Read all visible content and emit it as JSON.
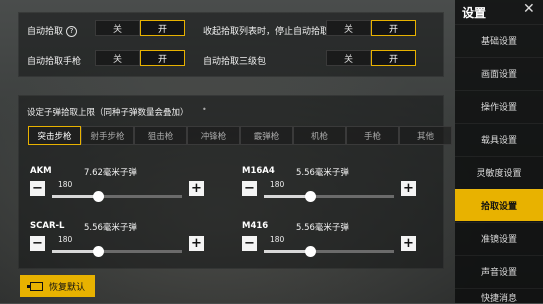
{
  "sidebar": {
    "title": "设置",
    "items": [
      {
        "label": "基础设置"
      },
      {
        "label": "画面设置"
      },
      {
        "label": "操作设置"
      },
      {
        "label": "载具设置"
      },
      {
        "label": "灵敏度设置"
      },
      {
        "label": "拾取设置",
        "active": true
      },
      {
        "label": "准镜设置"
      },
      {
        "label": "声音设置"
      },
      {
        "label": "快捷消息"
      }
    ]
  },
  "toggles": [
    {
      "label": "自动拾取",
      "off": "关",
      "on": "开",
      "value": "开",
      "has_help": true
    },
    {
      "label": "收起拾取列表时，停止自动拾取",
      "off": "关",
      "on": "开",
      "value": "开"
    },
    {
      "label": "自动拾取手枪",
      "off": "关",
      "on": "开",
      "value": "开"
    },
    {
      "label": "自动拾取三级包",
      "off": "关",
      "on": "开",
      "value": "开"
    }
  ],
  "ammo_section": {
    "title": "设定子弹拾取上限（同种子弹数量会叠加）",
    "tabs": [
      "突击步枪",
      "射手步枪",
      "狙击枪",
      "冲锋枪",
      "霰弹枪",
      "机枪",
      "手枪",
      "其他"
    ],
    "active_tab": "突击步枪",
    "weapons": [
      {
        "name": "AKM",
        "ammo": "7.62毫米子弹",
        "value": "180",
        "level": 0.5
      },
      {
        "name": "M16A4",
        "ammo": "5.56毫米子弹",
        "value": "180",
        "level": 0.5
      },
      {
        "name": "SCAR-L",
        "ammo": "5.56毫米子弹",
        "value": "180",
        "level": 0.5
      },
      {
        "name": "M416",
        "ammo": "5.56毫米子弹",
        "value": "180",
        "level": 0.5
      }
    ],
    "minus": "−",
    "plus": "+"
  },
  "reset_label": "恢复默认",
  "colors": {
    "accent": "#e8b200"
  }
}
